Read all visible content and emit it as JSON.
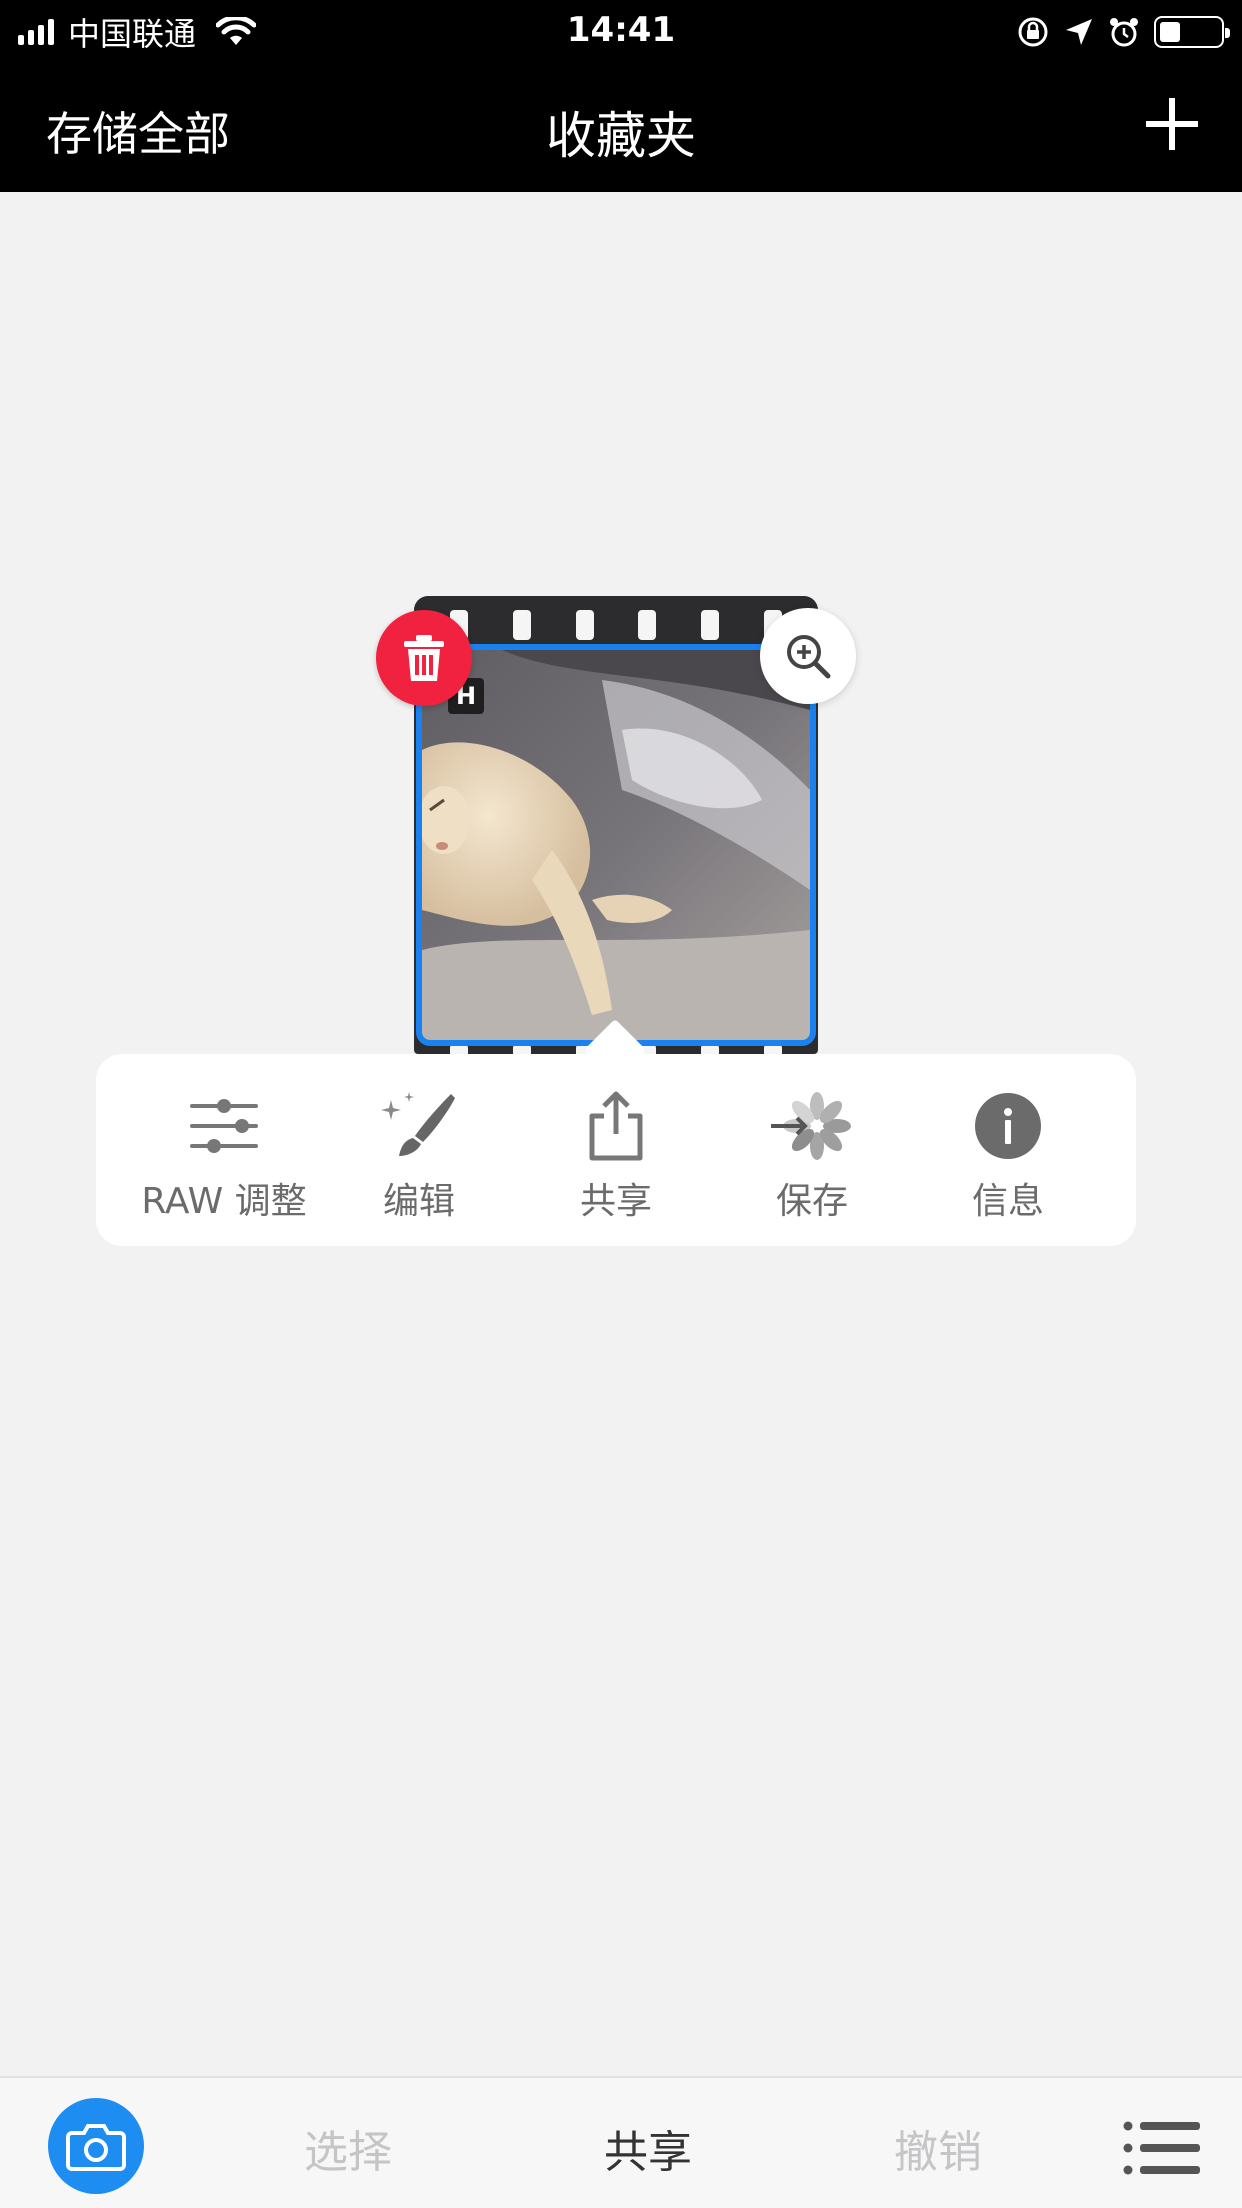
{
  "status_bar": {
    "carrier": "中国联通",
    "time": "14:41",
    "battery_level": 0.35
  },
  "nav": {
    "left_label": "存储全部",
    "title": "收藏夹",
    "add_icon": "plus-icon"
  },
  "photo": {
    "badge": "H",
    "delete_icon": "trash-icon",
    "zoom_icon": "zoom-in-icon",
    "accent": "#1a82f0"
  },
  "popup_menu": {
    "items": [
      {
        "label": "RAW 调整",
        "icon": "sliders-icon"
      },
      {
        "label": "编辑",
        "icon": "magic-brush-icon"
      },
      {
        "label": "共享",
        "icon": "share-icon"
      },
      {
        "label": "保存",
        "icon": "save-to-photos-icon"
      },
      {
        "label": "信息",
        "icon": "info-icon"
      }
    ]
  },
  "toolbar": {
    "camera_icon": "camera-icon",
    "select_label": "选择",
    "share_label": "共享",
    "undo_label": "撤销",
    "menu_icon": "list-menu-icon",
    "camera_color": "#1e8df2"
  }
}
